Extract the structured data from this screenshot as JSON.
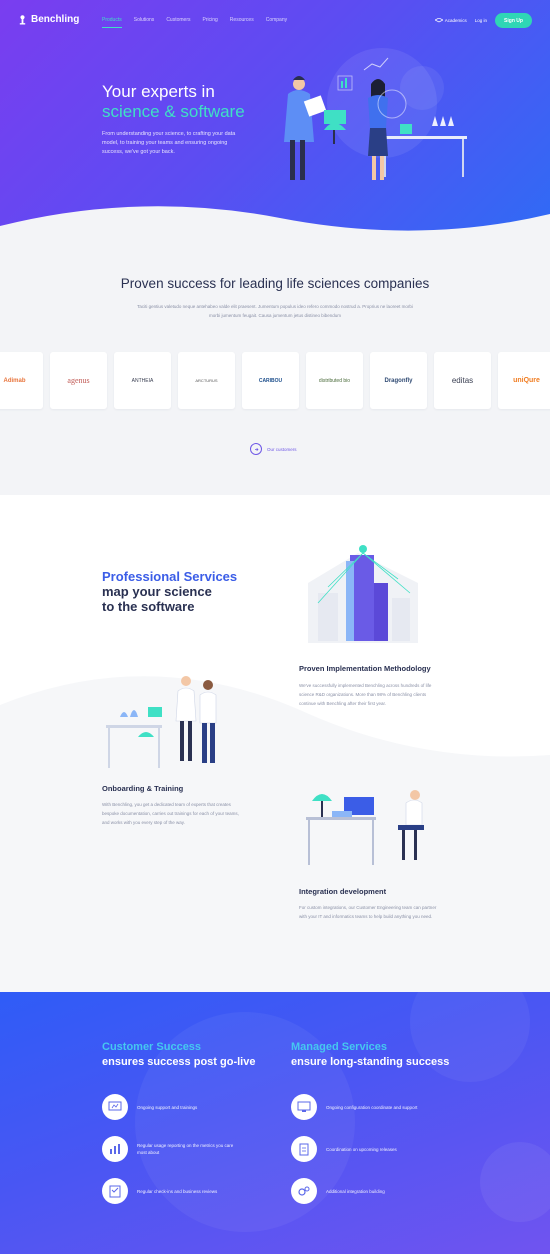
{
  "nav": {
    "logo": "Benchling",
    "links": [
      "Products",
      "Solutions",
      "Customers",
      "Pricing",
      "Resources",
      "Company"
    ],
    "academics": "Academics",
    "login": "Log in",
    "signup": "Sign Up"
  },
  "hero": {
    "title_line1": "Your experts in",
    "title_line2": "science & software",
    "description": "From understanding your science, to crafting your data model, to training your teams and ensuring ongoing success, we've got your back."
  },
  "proven": {
    "title": "Proven success for leading life sciences companies",
    "description": "Taciti gentius valetudo neque antehabeo valde elit praesent. Jumentum populus ideo refero commodo nostrud a. Proprius ne laoreet morbi morbi jumentum feugait. Causa jumentum jetus distineo bibendum",
    "logos": [
      "Adimab",
      "agenus",
      "ANTHEIA",
      "ARCTURUS",
      "CARIBOU",
      "distributed bio",
      "Dragonfly",
      "editas",
      "uniQure"
    ],
    "our_customers": "Our customers"
  },
  "services": {
    "title_accent": "Professional Services",
    "title_line2": "map your science",
    "title_line3": "to the software",
    "items": [
      {
        "heading": "Proven Implementation Methodology",
        "body": "We've successfully implemented Benchling across hundreds of life science R&D organizations. More than 98% of Benchling clients continue with Benchling after their first year."
      },
      {
        "heading": "Onboarding & Training",
        "body": "With Benchling, you get a dedicated team of experts that creates bespoke documentation, carries out trainings for each of your teams, and works with you every step of the way."
      },
      {
        "heading": "Integration development",
        "body": "For custom integrations, our Customer Engineering team can partner with your IT and informatics teams to help build anything you need."
      }
    ]
  },
  "cta": {
    "left": {
      "title_accent": "Customer Success",
      "title_line2": "ensures success post go-live",
      "items": [
        "Ongoing support and trainings",
        "Regular usage reporting on the metrics you care most about",
        "Regular check-ins and business reviews"
      ]
    },
    "right": {
      "title_accent": "Managed Services",
      "title_line2": "ensure long-standing success",
      "items": [
        "Ongoing configuration coordinate and support",
        "Coordination on upcoming releases",
        "Additional integration building"
      ]
    }
  },
  "colors": {
    "teal": "#3fe0c5",
    "purple": "#6e57e6",
    "blue": "#3b5de7",
    "sky": "#45c8f0"
  }
}
